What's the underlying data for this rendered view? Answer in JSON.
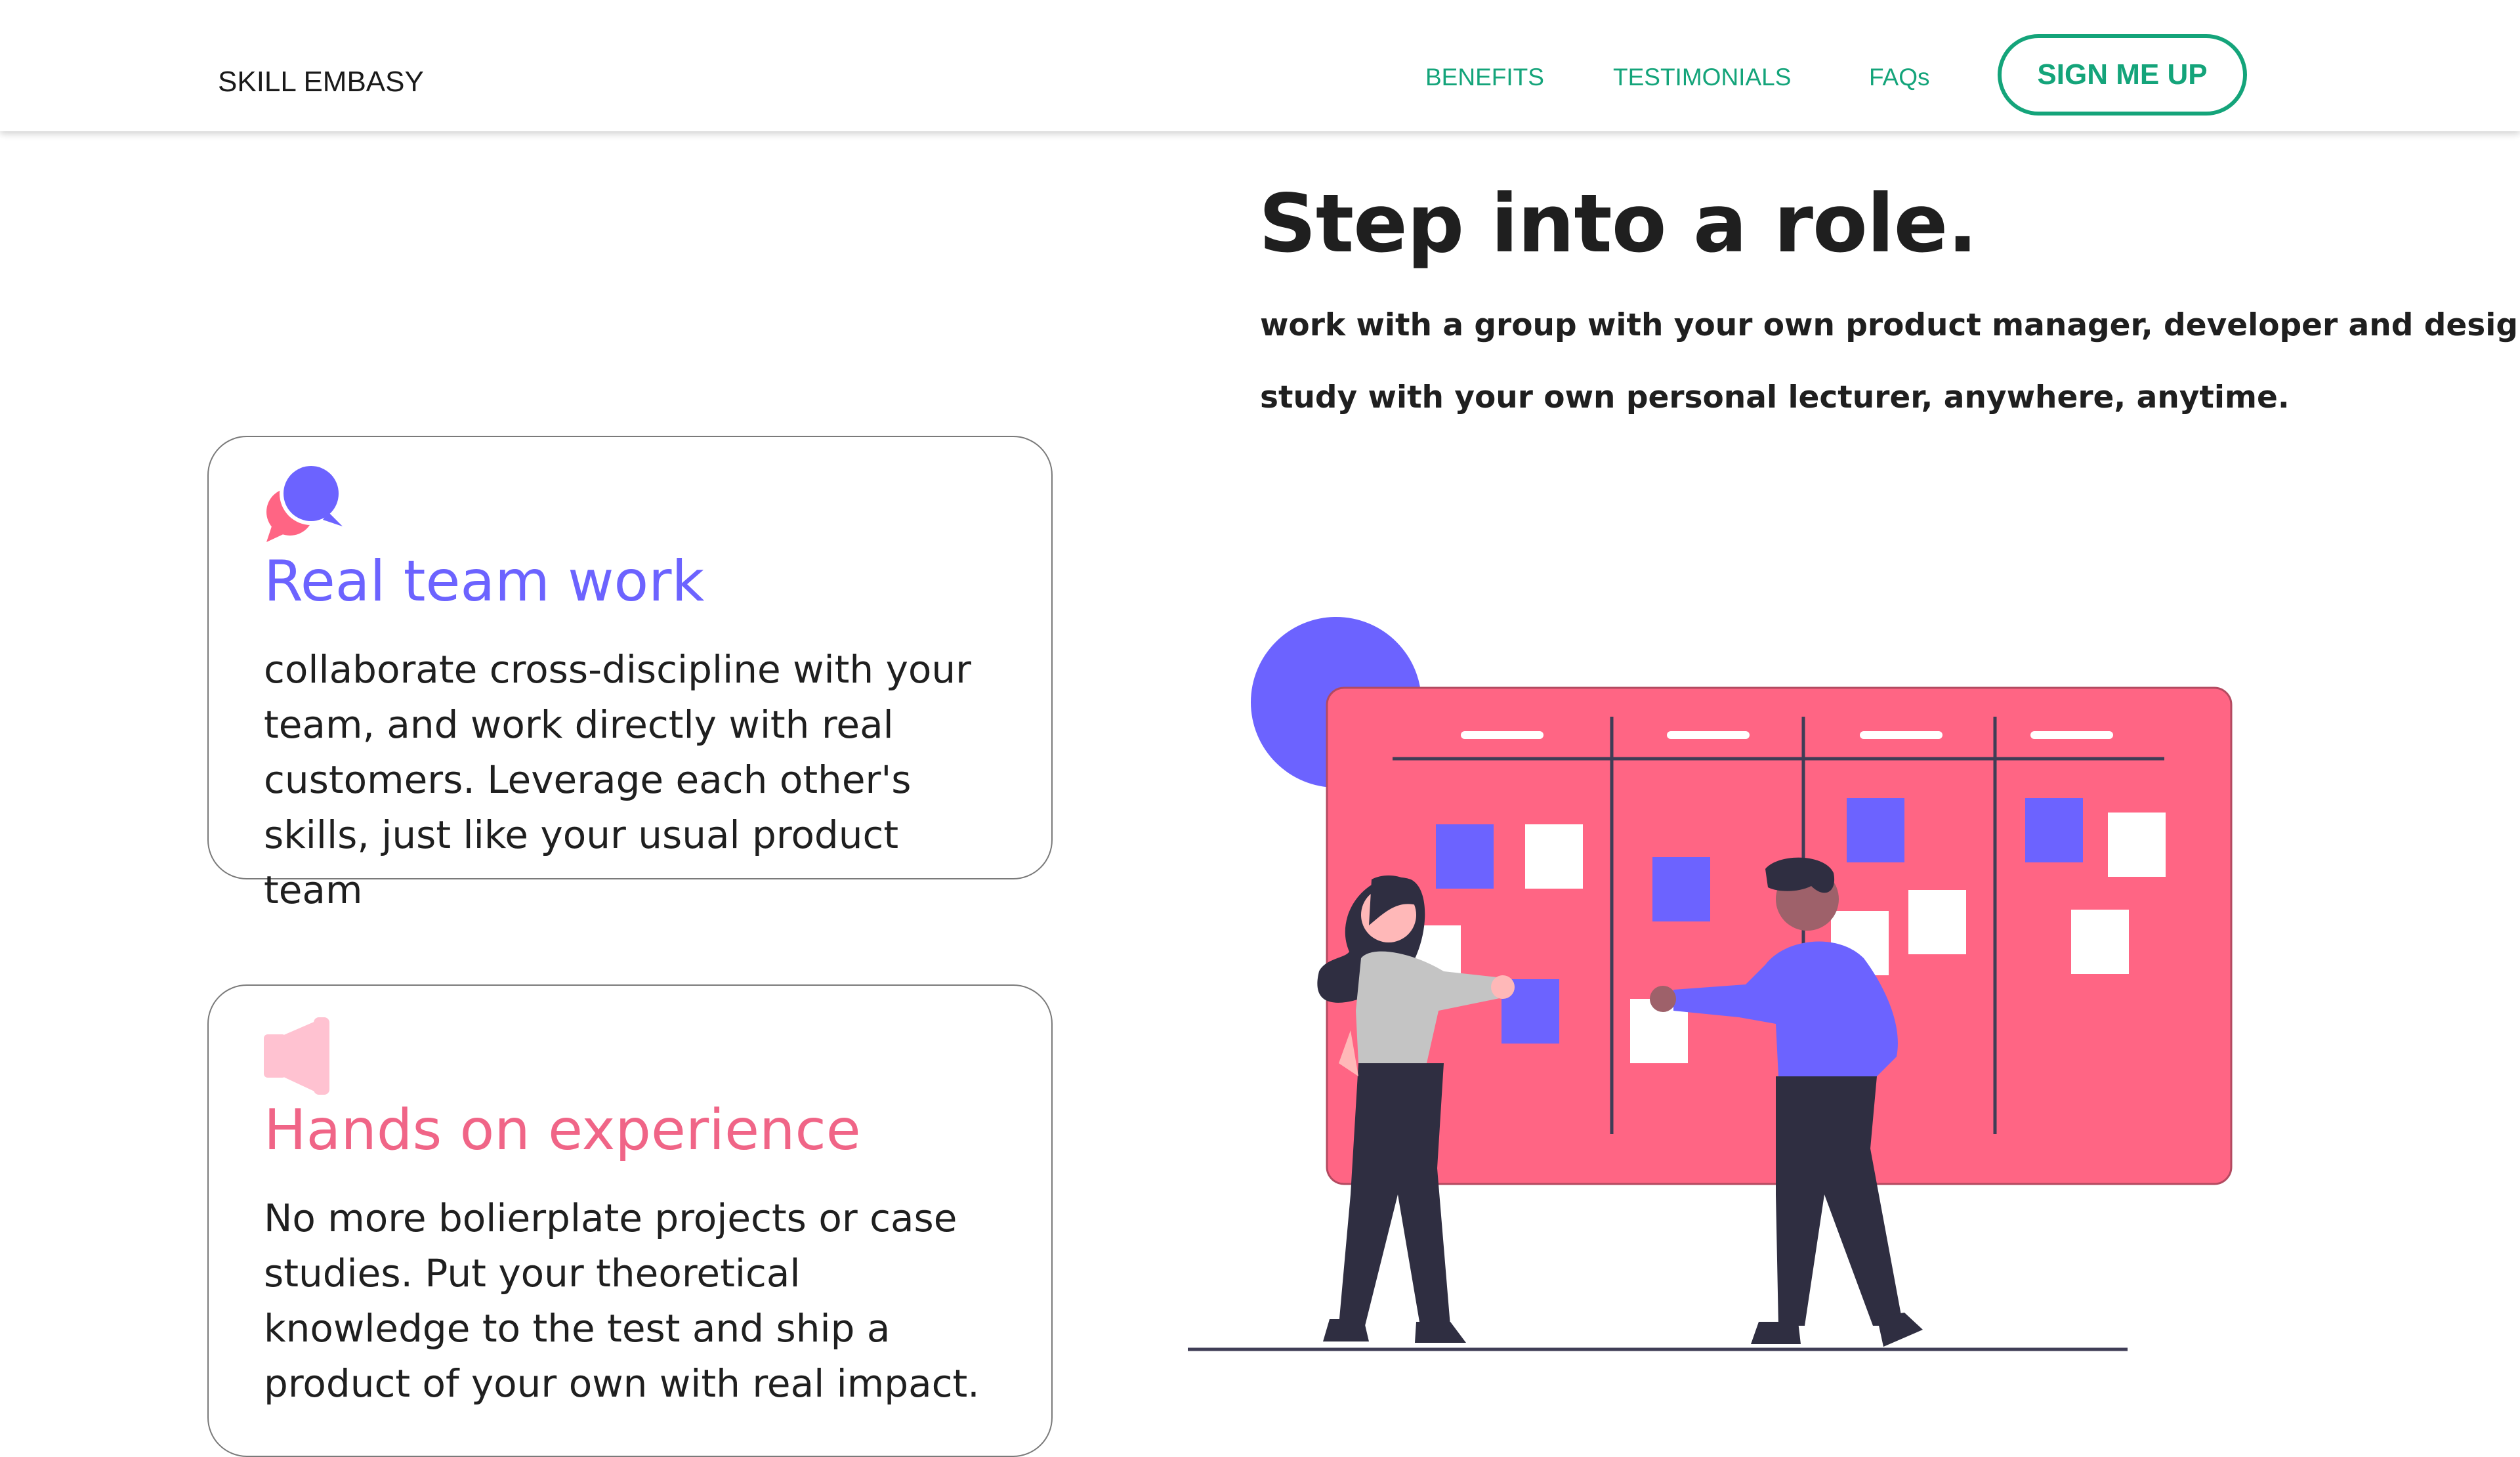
{
  "nav": {
    "brand": "SKILL EMBASY",
    "links": [
      "BENEFITS",
      "TESTIMONIALS",
      "FAQs"
    ],
    "cta": "SIGN ME UP"
  },
  "hero": {
    "title": "Step into a role.",
    "lines": [
      "work with a group with your own product manager, developer and designer.",
      "study with your own personal lecturer, anywhere, anytime."
    ]
  },
  "cards": [
    {
      "title": "Real team work",
      "text": "collaborate cross-discipline with your team, and  work directly with real customers. Leverage each other's skills, just like your usual product team",
      "icon": "chat-bubbles-icon",
      "title_color": "#6c63ff"
    },
    {
      "title": "Hands on experience",
      "text": "No more bolierplate projects or case studies. Put your theoretical knowledge to the test and ship a product of your own with real impact.",
      "icon": "megaphone-icon",
      "title_color": "#f06587"
    }
  ],
  "colors": {
    "accent_green": "#14a47a",
    "purple": "#6c63ff",
    "pink": "#ff6584",
    "dark": "#2f2e41"
  }
}
